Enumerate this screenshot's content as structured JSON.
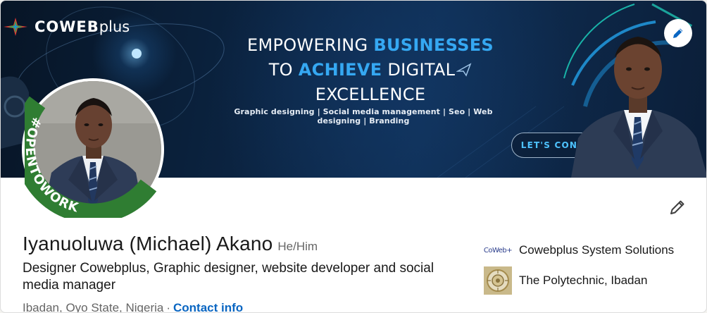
{
  "banner": {
    "logo": {
      "name": "COWEB",
      "suffix": "plus"
    },
    "headline": {
      "line1_plain": "EMPOWERING ",
      "line1_highlight": "BUSINESSES",
      "line2_plain_before": "TO ",
      "line2_highlight": "ACHIEVE",
      "line2_plain_after": " DIGITAL",
      "line3": "EXCELLENCE"
    },
    "services": "Graphic designing | Social media management | Seo | Web designing | Branding",
    "cta": "LET'S CONNECT"
  },
  "avatar": {
    "badge_text": "#OPENTOWORK"
  },
  "profile": {
    "name": "Iyanuoluwa (Michael) Akano",
    "pronouns": "He/Him",
    "headline": "Designer Cowebplus, Graphic designer, website developer and social media manager",
    "location": "Ibadan, Oyo State, Nigeria",
    "separator": "·",
    "contact_label": "Contact info"
  },
  "experience": {
    "company_logo_text": "CoWeb+",
    "company_name": "Cowebplus System Solutions",
    "school_name": "The Polytechnic, Ibadan"
  },
  "icons": {
    "edit_banner": "pencil-icon",
    "edit_profile": "pencil-icon"
  },
  "colors": {
    "accent_link": "#0a66c2",
    "open_to_work_green": "#2f7d32",
    "banner_highlight": "#35a8f2"
  }
}
